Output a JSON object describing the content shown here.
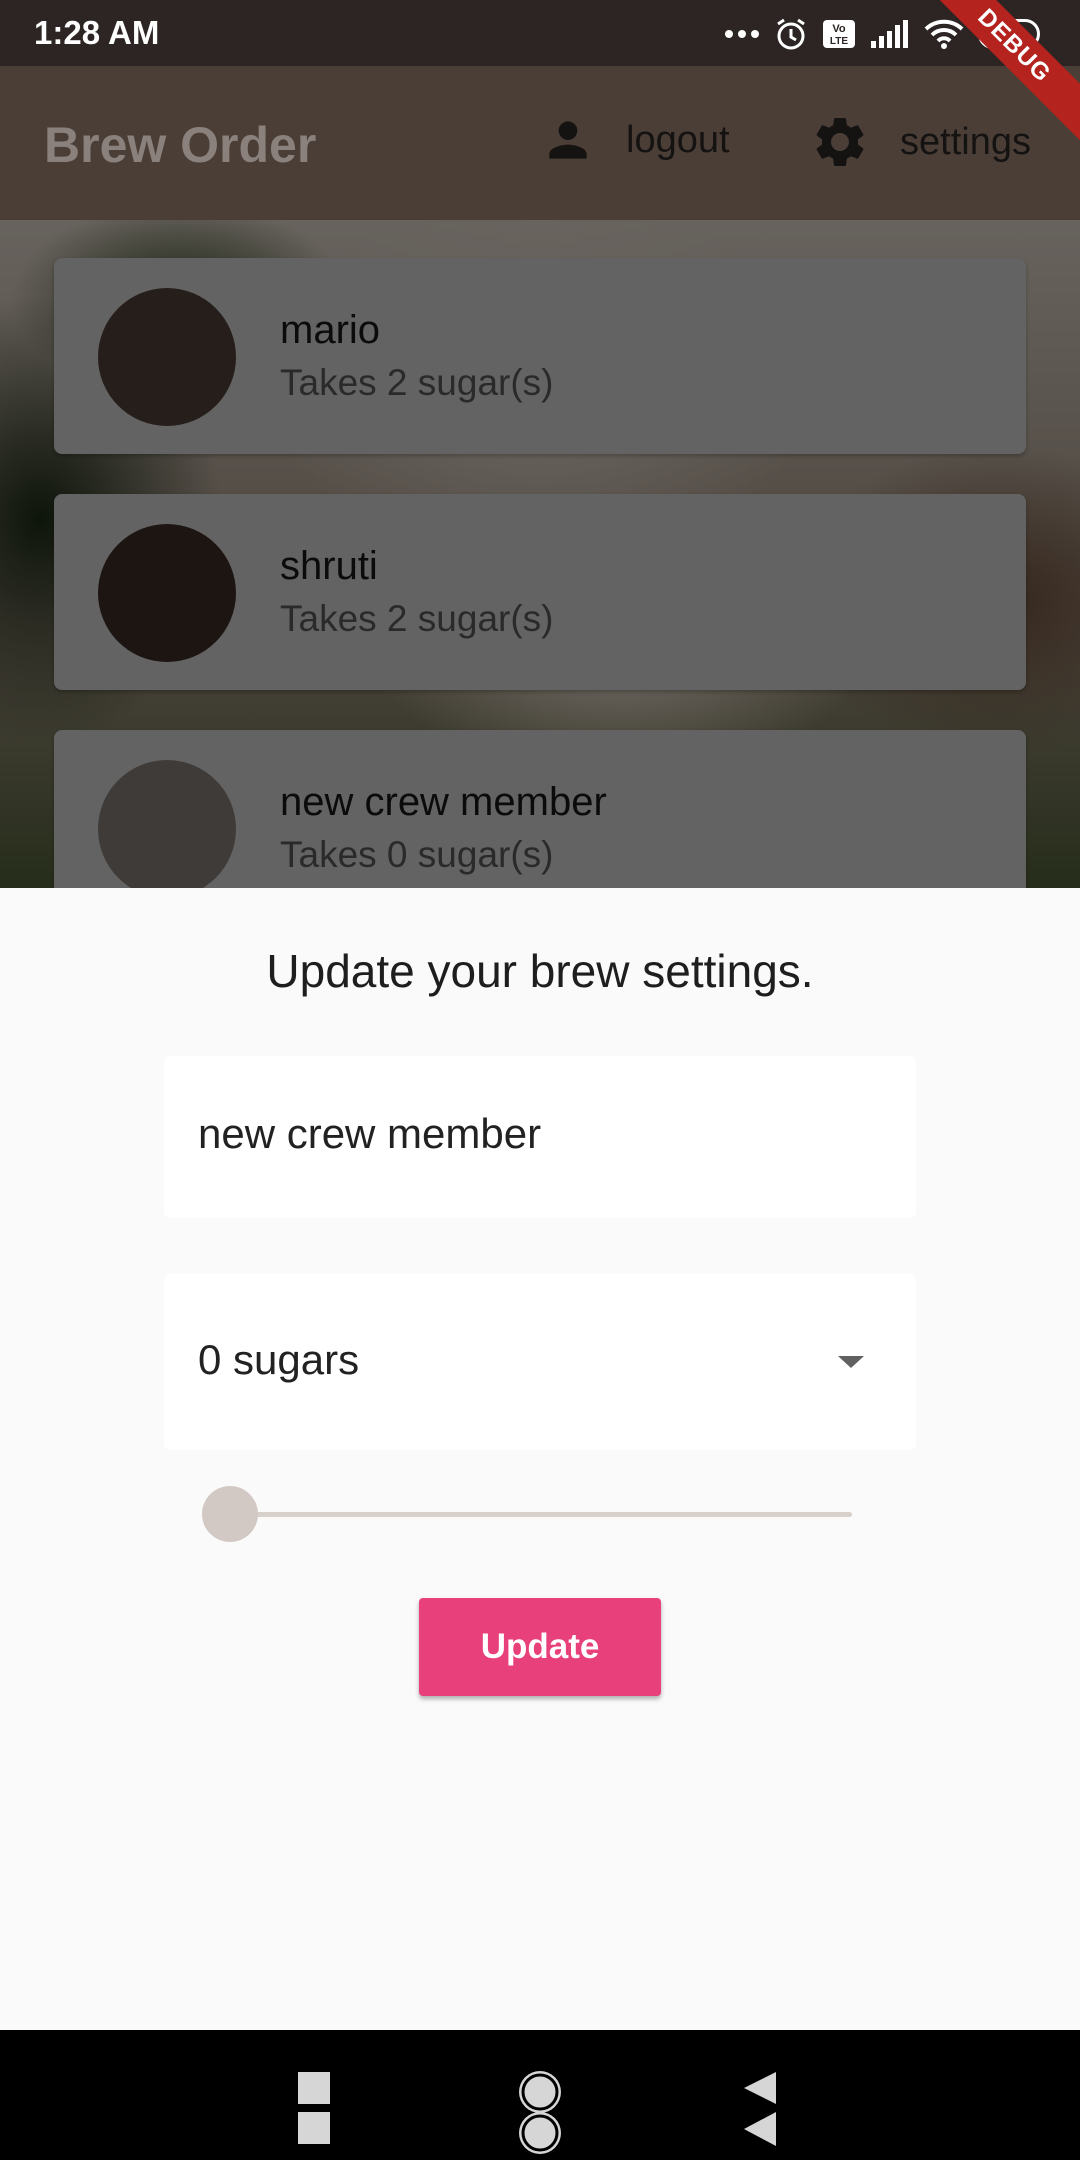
{
  "status_bar": {
    "time": "1:28 AM",
    "battery": "52",
    "icons": [
      "more-dots-icon",
      "alarm-icon",
      "volte-icon",
      "signal-icon",
      "wifi-icon",
      "battery-icon"
    ]
  },
  "debug_banner": "DEBUG",
  "app_bar": {
    "title": "Brew Order",
    "logout_label": "logout",
    "settings_label": "settings"
  },
  "brews": [
    {
      "name": "mario",
      "subtitle": "Takes 2 sugar(s)",
      "avatar_color": "#4c3d34"
    },
    {
      "name": "shruti",
      "subtitle": "Takes 2 sugar(s)",
      "avatar_color": "#3a2a24"
    },
    {
      "name": "new crew member",
      "subtitle": "Takes 0 sugar(s)",
      "avatar_color": "#7e7770"
    }
  ],
  "settings_sheet": {
    "title": "Update your brew settings.",
    "name_value": "new crew member",
    "sugars_value": "0 sugars",
    "strength_level": 0,
    "update_label": "Update"
  },
  "colors": {
    "accent": "#e8407a",
    "app_bar": "#4b3e37",
    "status_bar": "#2c2523"
  }
}
